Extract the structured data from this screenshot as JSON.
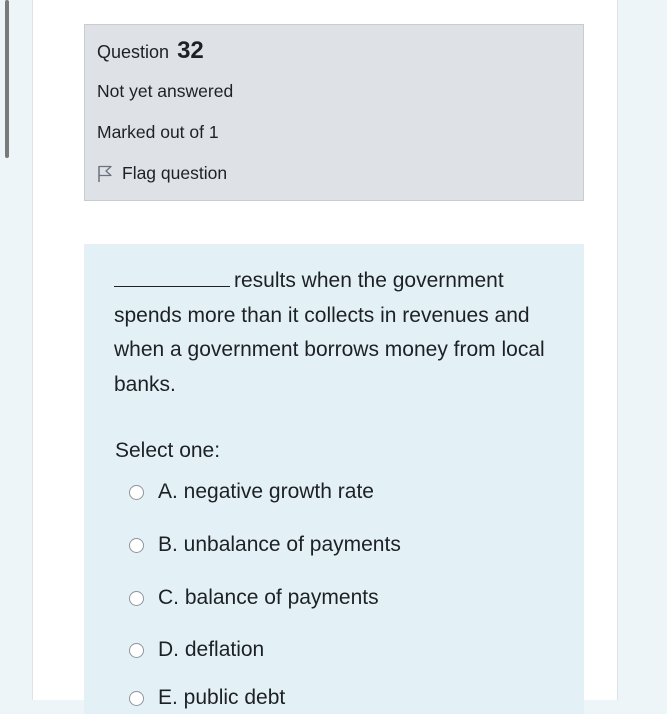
{
  "question": {
    "label": "Question",
    "number": "32",
    "status": "Not yet answered",
    "marks": "Marked out of 1",
    "flag_label": "Flag question"
  },
  "content": {
    "question_text": "results when the government spends more than it collects in revenues and when a government borrows money from local banks.",
    "prompt": "Select one:",
    "options": [
      {
        "label": "A. negative growth rate"
      },
      {
        "label": "B. unbalance of payments"
      },
      {
        "label": "C. balance of payments"
      },
      {
        "label": "D. deflation"
      },
      {
        "label": "E. public debt"
      }
    ]
  }
}
